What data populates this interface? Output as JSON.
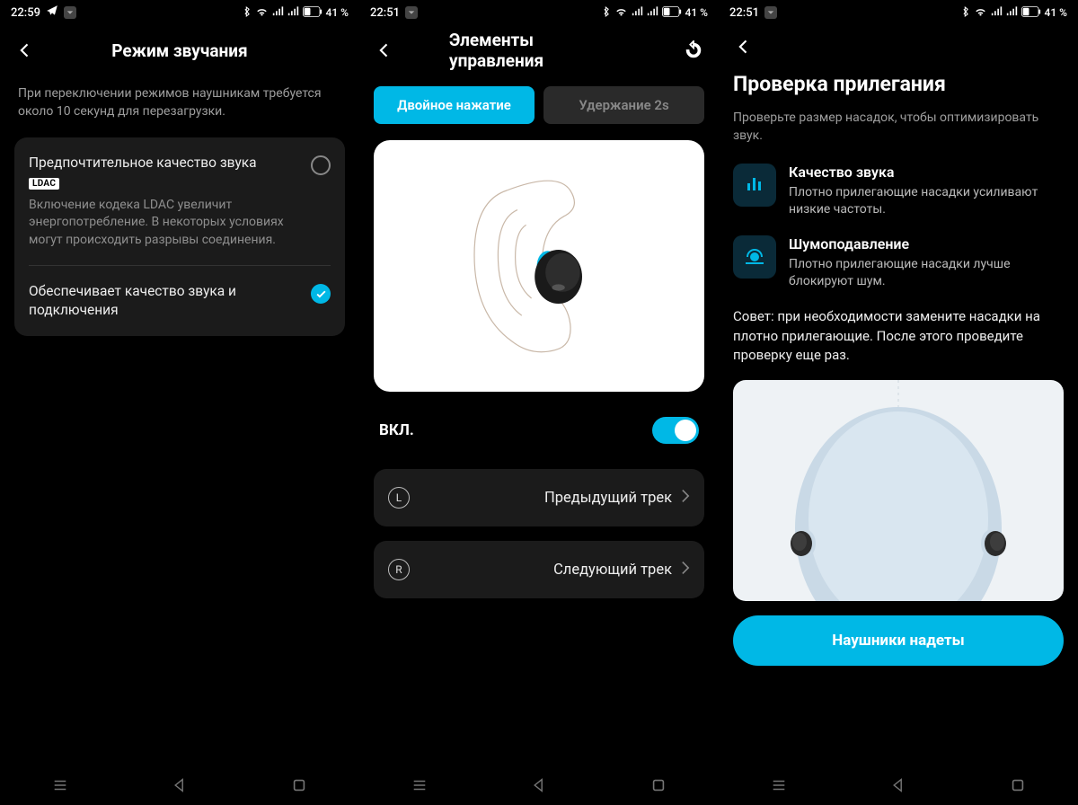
{
  "status": {
    "time1": "22:59",
    "time2": "22:51",
    "time3": "22:51",
    "battery": "41 %"
  },
  "screen1": {
    "title": "Режим звучания",
    "subtitle": "При переключении режимов наушникам требуется около 10 секунд для перезагрузки.",
    "opt1": {
      "title": "Предпочтительное качество звука",
      "badge": "LDAC",
      "desc": "Включение кодека LDAC увеличит энергопотребление. В некоторых условиях могут происходить разрывы соединения."
    },
    "opt2": {
      "title": "Обеспечивает качество звука и подключения"
    }
  },
  "screen2": {
    "title": "Элементы управления",
    "tab1": "Двойное нажатие",
    "tab2": "Удержание 2s",
    "toggle_label": "ВКЛ.",
    "left_badge": "L",
    "right_badge": "R",
    "left_action": "Предыдущий трек",
    "right_action": "Следующий трек"
  },
  "screen3": {
    "title": "Проверка прилегания",
    "subtitle": "Проверьте размер насадок, чтобы оптимизировать звук.",
    "info1": {
      "title": "Качество звука",
      "desc": "Плотно прилегающие насадки усиливают низкие частоты."
    },
    "info2": {
      "title": "Шумоподавление",
      "desc": "Плотно прилегающие насадки лучше блокируют шум."
    },
    "tip": "Совет: при необходимости замените насадки на плотно прилегающие. После этого проведите проверку еще раз.",
    "cta": "Наушники надеты"
  }
}
